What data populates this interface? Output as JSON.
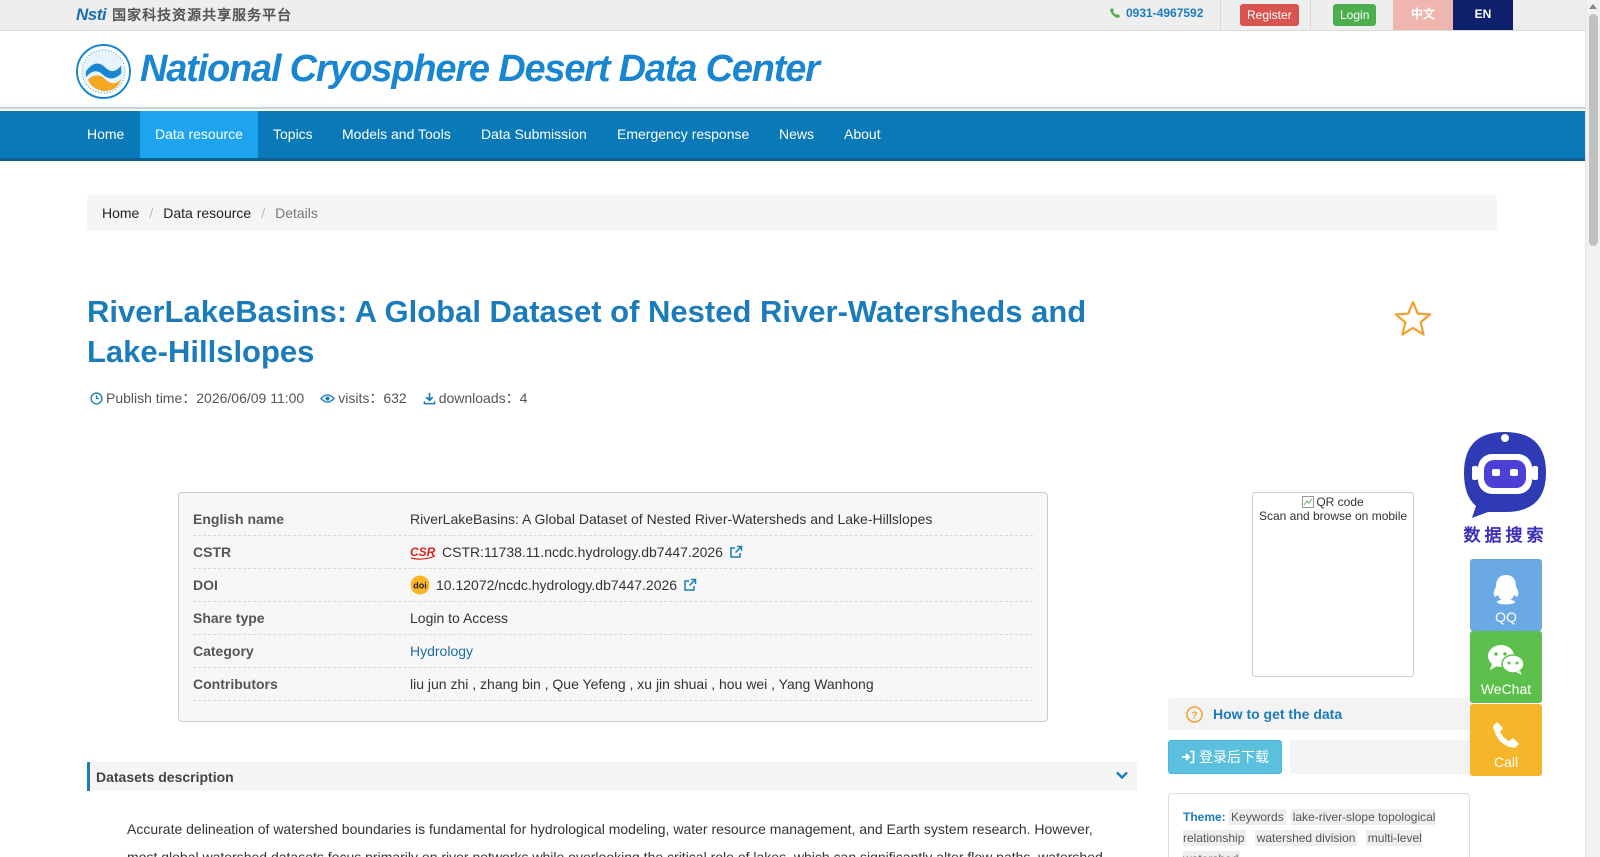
{
  "topbar": {
    "platform_logo_text": "Nsti",
    "platform_name": "国家科技资源共享服务平台",
    "phone": "0931-4967592",
    "register_label": "Register",
    "login_label": "Login",
    "lang_zh": "中文",
    "lang_en": "EN"
  },
  "header": {
    "title": "National Cryosphere Desert Data Center"
  },
  "nav": {
    "items": [
      {
        "label": "Home"
      },
      {
        "label": "Data resource"
      },
      {
        "label": "Topics"
      },
      {
        "label": "Models and Tools"
      },
      {
        "label": "Data Submission"
      },
      {
        "label": "Emergency response"
      },
      {
        "label": "News"
      },
      {
        "label": "About"
      }
    ],
    "active": "Data resource"
  },
  "breadcrumb": {
    "items": [
      "Home",
      "Data resource"
    ],
    "current": "Details"
  },
  "dataset": {
    "title": "RiverLakeBasins: A Global Dataset of Nested River-Watersheds and Lake-Hillslopes",
    "publish_time": "Publish time：2026/06/09 11:00",
    "visits": "visits：632",
    "downloads": "downloads：4"
  },
  "info": {
    "rows": [
      {
        "key": "English name",
        "value": "RiverLakeBasins: A Global Dataset of Nested River-Watersheds and Lake-Hillslopes"
      },
      {
        "key": "CSTR",
        "value": "CSTR:11738.11.ncdc.hydrology.db7447.2026"
      },
      {
        "key": "DOI",
        "value": "10.12072/ncdc.hydrology.db7447.2026"
      },
      {
        "key": "Share type",
        "value": "Login to Access"
      },
      {
        "key": "Category",
        "value": "Hydrology"
      },
      {
        "key": "Contributors",
        "value": "liu jun zhi , zhang bin , Que Yefeng , xu jin shuai , hou wei , Yang Wanhong"
      }
    ]
  },
  "qr": {
    "alt": "QR code",
    "caption": "Scan and browse on mobile"
  },
  "access": {
    "howto_label": "How to get the data",
    "download_label": "登录后下载"
  },
  "theme": {
    "label": "Theme:",
    "keywords_label": "Keywords",
    "tags": [
      "lake-river-slope topological relationship",
      "watershed division",
      "multi-level watershed"
    ]
  },
  "description": {
    "heading": "Datasets description",
    "text": "Accurate delineation of watershed boundaries is fundamental for hydrological modeling, water resource management, and Earth system research. However, most global watershed datasets focus primarily on river networks while overlooking the critical role of lakes, which can significantly alter flow paths, watershed"
  },
  "side": {
    "robot_label": "数据搜索",
    "qq": "QQ",
    "wechat": "WeChat",
    "call": "Call"
  },
  "colors": {
    "nav_bg": "#0a79b8",
    "nav_active": "#1ea4ef",
    "title_blue": "#1c7cba",
    "register_red": "#d9534f",
    "login_green": "#4cae4c",
    "lang_en_bg": "#0e1f6b",
    "lang_zh_bg": "#efb6b0"
  }
}
